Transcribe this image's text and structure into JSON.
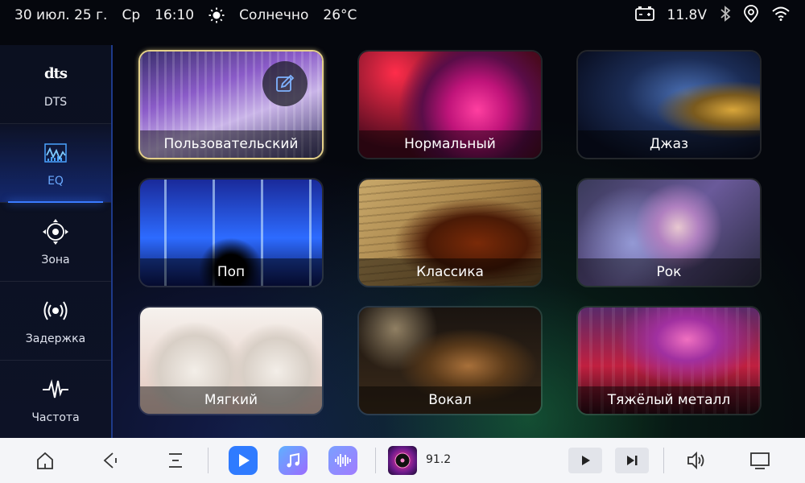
{
  "status_bar": {
    "date": "30 июл. 25 г.",
    "weekday": "Ср",
    "time": "16:10",
    "weather": "Солнечно",
    "temperature": "26°C",
    "voltage": "11.8V"
  },
  "sidebar": {
    "items": [
      {
        "label": "DTS",
        "logo": "dts",
        "icon": "dts-logo"
      },
      {
        "label": "EQ",
        "icon": "equalizer-icon",
        "active": true
      },
      {
        "label": "Зона",
        "icon": "zone-icon"
      },
      {
        "label": "Задержка",
        "icon": "delay-icon"
      },
      {
        "label": "Частота",
        "icon": "frequency-icon"
      }
    ]
  },
  "presets": [
    {
      "label": "Пользовательский",
      "selected": true,
      "editable": true
    },
    {
      "label": "Нормальный"
    },
    {
      "label": "Джаз"
    },
    {
      "label": "Поп"
    },
    {
      "label": "Классика"
    },
    {
      "label": "Рок"
    },
    {
      "label": "Мягкий"
    },
    {
      "label": "Вокал"
    },
    {
      "label": "Тяжёлый металл"
    }
  ],
  "bottom_bar": {
    "radio_frequency": "91.2",
    "icons": [
      "home-icon",
      "back-icon",
      "menu-icon",
      "video-player-icon",
      "music-icon",
      "voice-icon",
      "radio-icon",
      "play-icon",
      "next-icon",
      "volume-icon",
      "screen-icon"
    ]
  },
  "colors": {
    "accent": "#3a7bff",
    "selected_border": "#e4d08a",
    "video_app": "#2f7bff",
    "music_app": "#7b6cff"
  }
}
